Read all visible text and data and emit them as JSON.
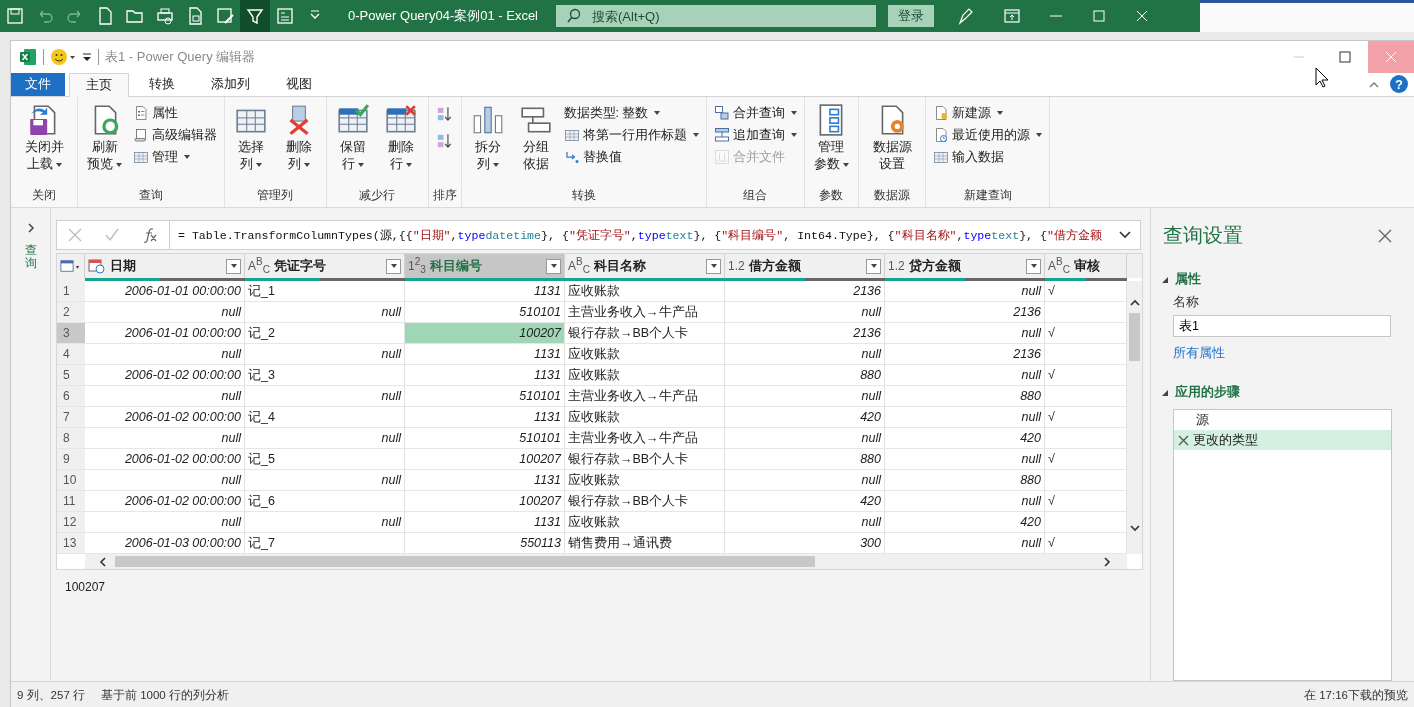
{
  "excel": {
    "title": "0-Power Query04-案例01  -  Excel",
    "search": {
      "placeholder": "搜索(Alt+Q)"
    },
    "sign_in": "登录"
  },
  "window": {
    "title": "表1 - Power Query 编辑器",
    "help": "?"
  },
  "tabs": [
    {
      "label": "文件",
      "kind": "file",
      "selected": false
    },
    {
      "label": "主页",
      "kind": "tab",
      "selected": true
    },
    {
      "label": "转换",
      "kind": "tab",
      "selected": false
    },
    {
      "label": "添加列",
      "kind": "tab",
      "selected": false
    },
    {
      "label": "视图",
      "kind": "tab",
      "selected": false
    }
  ],
  "ribbon": {
    "groups": [
      {
        "label": "关闭",
        "items": [
          {
            "kind": "large",
            "label": "关闭并上载",
            "dropdown": true,
            "disabled": false
          }
        ]
      },
      {
        "label": "查询",
        "items": [
          {
            "kind": "large",
            "label": "刷新预览",
            "dropdown": true,
            "disabled": false
          },
          {
            "kind": "small",
            "label": "属性",
            "dropdown": false,
            "disabled": false
          },
          {
            "kind": "small",
            "label": "高级编辑器",
            "dropdown": false,
            "disabled": false
          },
          {
            "kind": "small",
            "label": "管理",
            "dropdown": true,
            "disabled": false
          }
        ]
      },
      {
        "label": "管理列",
        "items": [
          {
            "kind": "large",
            "label": "选择列",
            "dropdown": true,
            "disabled": false
          },
          {
            "kind": "large",
            "label": "删除列",
            "dropdown": true,
            "disabled": false
          }
        ]
      },
      {
        "label": "减少行",
        "items": [
          {
            "kind": "large",
            "label": "保留行",
            "dropdown": true,
            "disabled": false
          },
          {
            "kind": "large",
            "label": "删除行",
            "dropdown": true,
            "disabled": false
          }
        ]
      },
      {
        "label": "排序",
        "items": [
          {
            "kind": "icon",
            "dropdown": false,
            "disabled": false
          },
          {
            "kind": "icon",
            "dropdown": false,
            "disabled": false
          }
        ]
      },
      {
        "label": "转换",
        "items": [
          {
            "kind": "large",
            "label": "拆分列",
            "dropdown": true,
            "disabled": false
          },
          {
            "kind": "large",
            "label": "分组依据",
            "dropdown": false,
            "disabled": false
          },
          {
            "kind": "small",
            "label": "数据类型: 整数",
            "dropdown": true,
            "disabled": false
          },
          {
            "kind": "small",
            "label": "将第一行用作标题",
            "dropdown": true,
            "disabled": false
          },
          {
            "kind": "small",
            "label": "替换值",
            "dropdown": false,
            "disabled": false
          }
        ]
      },
      {
        "label": "组合",
        "items": [
          {
            "kind": "small",
            "label": "合并查询",
            "dropdown": true,
            "disabled": false
          },
          {
            "kind": "small",
            "label": "追加查询",
            "dropdown": true,
            "disabled": false
          },
          {
            "kind": "small",
            "label": "合并文件",
            "dropdown": false,
            "disabled": true
          }
        ]
      },
      {
        "label": "参数",
        "items": [
          {
            "kind": "large",
            "label": "管理参数",
            "dropdown": true,
            "disabled": false
          }
        ]
      },
      {
        "label": "数据源",
        "items": [
          {
            "kind": "large",
            "label": "数据源设置",
            "dropdown": false,
            "disabled": false
          }
        ]
      },
      {
        "label": "新建查询",
        "items": [
          {
            "kind": "small",
            "label": "新建源",
            "dropdown": true,
            "disabled": false
          },
          {
            "kind": "small",
            "label": "最近使用的源",
            "dropdown": true,
            "disabled": false
          },
          {
            "kind": "small",
            "label": "输入数据",
            "dropdown": false,
            "disabled": false
          }
        ]
      }
    ]
  },
  "queries_pane": {
    "label": "查询",
    "expanded": false
  },
  "formula": {
    "tokens": [
      {
        "kind": "plain",
        "text": "= Table.TransformColumnTypes(源,{{"
      },
      {
        "kind": "string",
        "text": "\"日期\""
      },
      {
        "kind": "plain",
        "text": ", "
      },
      {
        "kind": "keyword",
        "text": "type"
      },
      {
        "kind": "type",
        "text": " datetime"
      },
      {
        "kind": "plain",
        "text": "}, {"
      },
      {
        "kind": "string",
        "text": "\"凭证字号\""
      },
      {
        "kind": "plain",
        "text": ", "
      },
      {
        "kind": "keyword",
        "text": "type"
      },
      {
        "kind": "type",
        "text": " text"
      },
      {
        "kind": "plain",
        "text": "}, {"
      },
      {
        "kind": "string",
        "text": "\"科目编号\""
      },
      {
        "kind": "plain",
        "text": ", Int64.Type}, {"
      },
      {
        "kind": "string",
        "text": "\"科目名称\""
      },
      {
        "kind": "plain",
        "text": ", "
      },
      {
        "kind": "keyword",
        "text": "type"
      },
      {
        "kind": "type",
        "text": " text"
      },
      {
        "kind": "plain",
        "text": "}, {"
      },
      {
        "kind": "string",
        "text": "\"借方金额"
      }
    ]
  },
  "table": {
    "columns": [
      {
        "name": "日期",
        "kind": "date",
        "level": 0.47,
        "selected": false
      },
      {
        "name": "凭证字号",
        "kind": "text",
        "type_label": "A$^{B}$$_{C}$",
        "level": 0.47,
        "selected": false
      },
      {
        "name": "科目编号",
        "kind": "number",
        "type_label": "1$^{2}$$_{3}$",
        "level": 1,
        "selected": true
      },
      {
        "name": "科目名称",
        "kind": "text",
        "type_label": "A$^{B}$$_{C}$",
        "level": 1,
        "selected": false
      },
      {
        "name": "借方金额",
        "kind": "number",
        "type_label": "1.2",
        "level": 0.5,
        "selected": false
      },
      {
        "name": "贷方金额",
        "kind": "number",
        "type_label": "1.2",
        "level": 0.5,
        "selected": false
      },
      {
        "name": "审核",
        "kind": "text",
        "type_label": "A$^{B}$$_{C}$",
        "level": 0.5,
        "selected": false
      }
    ],
    "rows": [
      {
        "number": "1",
        "selected": false,
        "cells": [
          "2006-01-01 00:00:00",
          "记_1",
          "1131",
          "应收账款",
          "2136",
          "null",
          "√"
        ]
      },
      {
        "number": "2",
        "selected": false,
        "cells": [
          "null",
          {
            "text": "null",
            "is_null": true
          },
          "510101",
          "主营业务收入→牛产品",
          "null",
          "2136"
        ]
      },
      {
        "number": "3",
        "selected": true,
        "cells": [
          "2006-01-01 00:00:00",
          "记_2",
          "100207",
          "银行存款→BB个人卡",
          "2136",
          "null",
          "√"
        ]
      },
      {
        "number": "4",
        "selected": false,
        "cells": [
          "null",
          {
            "text": "null",
            "is_null": true
          },
          "1131",
          "应收账款",
          "null",
          "2136"
        ]
      },
      {
        "number": "5",
        "selected": false,
        "cells": [
          "2006-01-02 00:00:00",
          "记_3",
          "1131",
          "应收账款",
          "880",
          "null",
          "√"
        ]
      },
      {
        "number": "6",
        "selected": false,
        "cells": [
          "null",
          {
            "text": "null",
            "is_null": true
          },
          "510101",
          "主营业务收入→牛产品",
          "null",
          "880"
        ]
      },
      {
        "number": "7",
        "selected": false,
        "cells": [
          "2006-01-02 00:00:00",
          "记_4",
          "1131",
          "应收账款",
          "420",
          "null",
          "√"
        ]
      },
      {
        "number": "8",
        "selected": false,
        "cells": [
          "null",
          {
            "text": "null",
            "is_null": true
          },
          "510101",
          "主营业务收入→牛产品",
          "null",
          "420"
        ]
      },
      {
        "number": "9",
        "selected": false,
        "cells": [
          "2006-01-02 00:00:00",
          "记_5",
          "100207",
          "银行存款→BB个人卡",
          "880",
          "null",
          "√"
        ]
      },
      {
        "number": "10",
        "selected": false,
        "cells": [
          "null",
          {
            "text": "null",
            "is_null": true
          },
          "1131",
          "应收账款",
          "null",
          "880"
        ]
      },
      {
        "number": "11",
        "selected": false,
        "cells": [
          "2006-01-02 00:00:00",
          "记_6",
          "100207",
          "银行存款→BB个人卡",
          "420",
          "null",
          "√"
        ]
      },
      {
        "number": "12",
        "selected": false,
        "cells": [
          "null",
          {
            "text": "null",
            "is_null": true
          },
          "1131",
          "应收账款",
          "null",
          "420"
        ]
      },
      {
        "number": "13",
        "selected": false,
        "cells": [
          "2006-01-03 00:00:00",
          "记_7",
          "550113",
          "销售费用→通讯费",
          "300",
          "null",
          "√"
        ]
      }
    ]
  },
  "preview": {
    "value": "100207"
  },
  "query_settings": {
    "title": "查询设置",
    "properties": {
      "heading": "属性",
      "expanded": true,
      "name_label": "名称",
      "name_value": "表1",
      "all_properties": "所有属性"
    },
    "steps": {
      "heading": "应用的步骤",
      "expanded": true,
      "items": [
        {
          "label": "源",
          "selected": false
        },
        {
          "label": "更改的类型",
          "selected": true
        }
      ]
    }
  },
  "status": {
    "columns_rows": "9 列、257 行",
    "profiling": "基于前 1000 行的列分析",
    "download": "在 17:16下载的预览"
  }
}
